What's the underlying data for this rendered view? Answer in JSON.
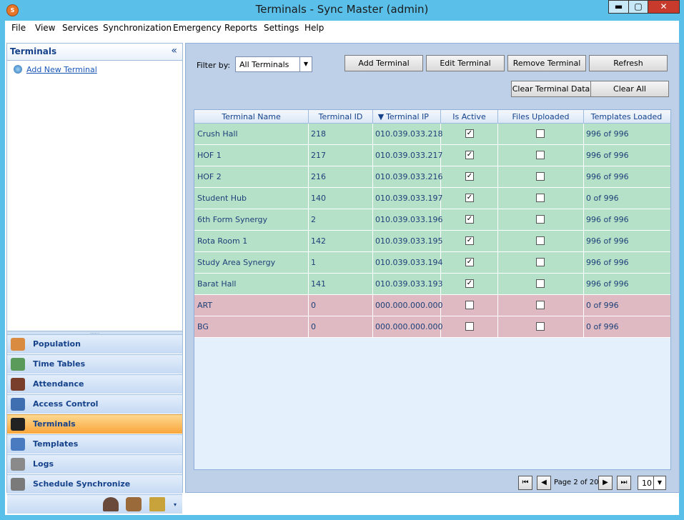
{
  "window": {
    "title": "Terminals - Sync Master (admin)",
    "app_icon": "S",
    "controls": {
      "minimize": "▬",
      "maximize": "▢",
      "close": "✕"
    }
  },
  "menubar": [
    "File",
    "View",
    "Services",
    "Synchronization",
    "Emergency",
    "Reports",
    "Settings",
    "Help"
  ],
  "sidebar": {
    "header": "Terminals",
    "collapse_glyph": "«",
    "add_link": "Add New Terminal",
    "nav": [
      {
        "label": "Population",
        "icon": "population-icon",
        "color": "#d98c3f"
      },
      {
        "label": "Time Tables",
        "icon": "time-tables-icon",
        "color": "#5a9a5a"
      },
      {
        "label": "Attendance",
        "icon": "attendance-icon",
        "color": "#7a3f2a"
      },
      {
        "label": "Access Control",
        "icon": "access-control-icon",
        "color": "#3f6fb0"
      },
      {
        "label": "Terminals",
        "icon": "terminals-icon",
        "color": "#222222",
        "selected": true
      },
      {
        "label": "Templates",
        "icon": "fingerprint-icon",
        "color": "#4a7ac0"
      },
      {
        "label": "Logs",
        "icon": "logs-icon",
        "color": "#8a8a8a"
      },
      {
        "label": "Schedule Synchronize",
        "icon": "stopwatch-icon",
        "color": "#7a7a7a"
      }
    ]
  },
  "toolbar": {
    "filter_label": "Filter by:",
    "filter_value": "All Terminals",
    "add": "Add Terminal",
    "edit": "Edit Terminal",
    "remove": "Remove Terminal",
    "refresh": "Refresh",
    "clear_data": "Clear Terminal Data",
    "clear_all": "Clear All"
  },
  "grid": {
    "columns": [
      "Terminal Name",
      "Terminal ID",
      "Terminal IP",
      "Is Active",
      "Files Uploaded",
      "Templates Loaded"
    ],
    "sort_glyph": "▼",
    "rows": [
      {
        "name": "Crush Hall",
        "id": "218",
        "ip": "010.039.033.218",
        "active": true,
        "files": false,
        "templates": "996 of 996",
        "status": "ok"
      },
      {
        "name": "HOF 1",
        "id": "217",
        "ip": "010.039.033.217",
        "active": true,
        "files": false,
        "templates": "996 of 996",
        "status": "ok"
      },
      {
        "name": "HOF 2",
        "id": "216",
        "ip": "010.039.033.216",
        "active": true,
        "files": false,
        "templates": "996 of 996",
        "status": "ok"
      },
      {
        "name": "Student Hub",
        "id": "140",
        "ip": "010.039.033.197",
        "active": true,
        "files": false,
        "templates": "0 of 996",
        "status": "ok"
      },
      {
        "name": "6th Form Synergy",
        "id": "2",
        "ip": "010.039.033.196",
        "active": true,
        "files": false,
        "templates": "996 of 996",
        "status": "ok"
      },
      {
        "name": "Rota Room 1",
        "id": "142",
        "ip": "010.039.033.195",
        "active": true,
        "files": false,
        "templates": "996 of 996",
        "status": "ok"
      },
      {
        "name": "Study Area Synergy",
        "id": "1",
        "ip": "010.039.033.194",
        "active": true,
        "files": false,
        "templates": "996 of 996",
        "status": "ok"
      },
      {
        "name": "Barat Hall",
        "id": "141",
        "ip": "010.039.033.193",
        "active": true,
        "files": false,
        "templates": "996 of 996",
        "status": "ok"
      },
      {
        "name": "ART",
        "id": "0",
        "ip": "000.000.000.000",
        "active": false,
        "files": false,
        "templates": "0 of 996",
        "status": "bad"
      },
      {
        "name": "BG",
        "id": "0",
        "ip": "000.000.000.000",
        "active": false,
        "files": false,
        "templates": "0 of 996",
        "status": "bad"
      }
    ]
  },
  "pager": {
    "first": "⏮",
    "prev": "◀",
    "text": "Page 2 of 20",
    "next": "▶",
    "last": "⏭",
    "page_size": "10",
    "page_size_arrow": "▼"
  },
  "colors": {
    "row_ok": "#b5e1c8",
    "row_bad": "#dfbac2",
    "selected_nav": "#f9a63a"
  }
}
